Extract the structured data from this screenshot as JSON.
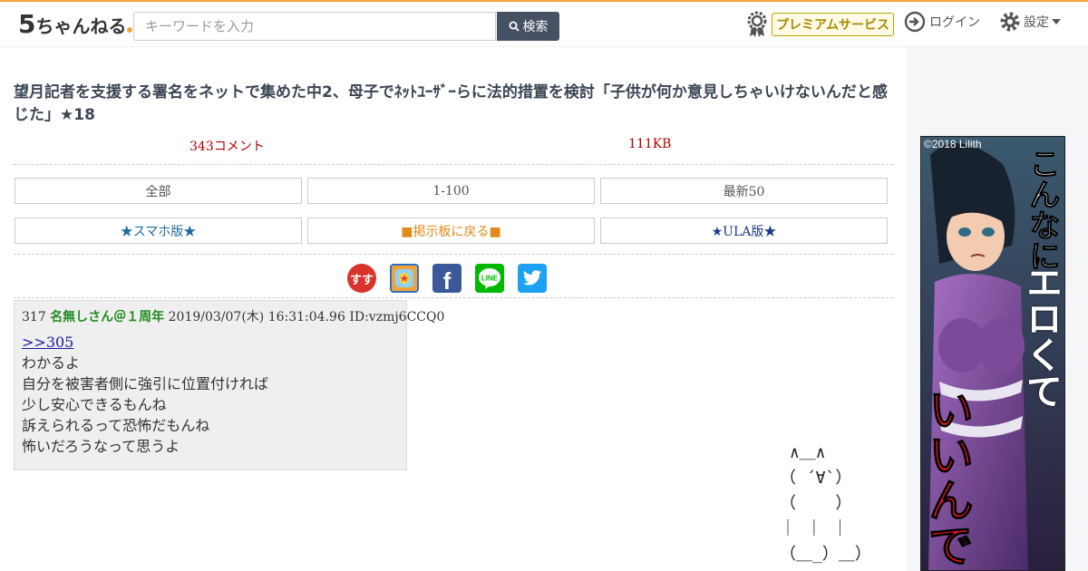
{
  "header": {
    "logo_number": "5",
    "logo_text": "ちゃんねる",
    "search_placeholder": "キーワードを入力",
    "search_button": "検索",
    "premium_label": "プレミアムサービス",
    "login_label": "ログイン",
    "settings_label": "設定"
  },
  "thread": {
    "title": "望月記者を支援する署名をネットで集めた中2、母子でﾈｯﾄﾕｰｻﾞｰらに法的措置を検討「子供が何か意見しちゃいけないんだと感じた」★18",
    "comments": "343コメント",
    "size": "111KB"
  },
  "nav": {
    "all": "全部",
    "range": "1-100",
    "latest": "最新50",
    "smartphone": "★スマホ版★",
    "back_board": "■掲示板に戻る■",
    "ula": "★ULA版★"
  },
  "share_icons": [
    "sukisuki-icon",
    "app-icon",
    "facebook-icon",
    "line-icon",
    "twitter-icon"
  ],
  "post": {
    "number": "317",
    "name": "名無しさん＠１周年",
    "date": "2019/03/07(木) 16:31:04.96",
    "id": "ID:vzmj6CCQ0",
    "anchor": ">>305",
    "lines": [
      "わかるよ",
      "自分を被害者側に強引に位置付ければ",
      "少し安心できるもんね",
      "訴えられるって恐怖だもんね",
      "怖いだろうなって思うよ"
    ]
  },
  "ascii_art": " ∧＿∧\n（ ´∀`）\n（    ）\n｜ ｜ ｜\n（＿_）＿）",
  "ad": {
    "copyright": "©2018 Lilith",
    "text_top": "こんなに",
    "text_mid": "エロくて",
    "text_bottom": "いいんで"
  },
  "colors": {
    "header_accent": "#f2a33a",
    "search_button": "#465264",
    "title_text": "#3c4653",
    "meta_red": "#b30000",
    "poster_name": "#228b22"
  }
}
